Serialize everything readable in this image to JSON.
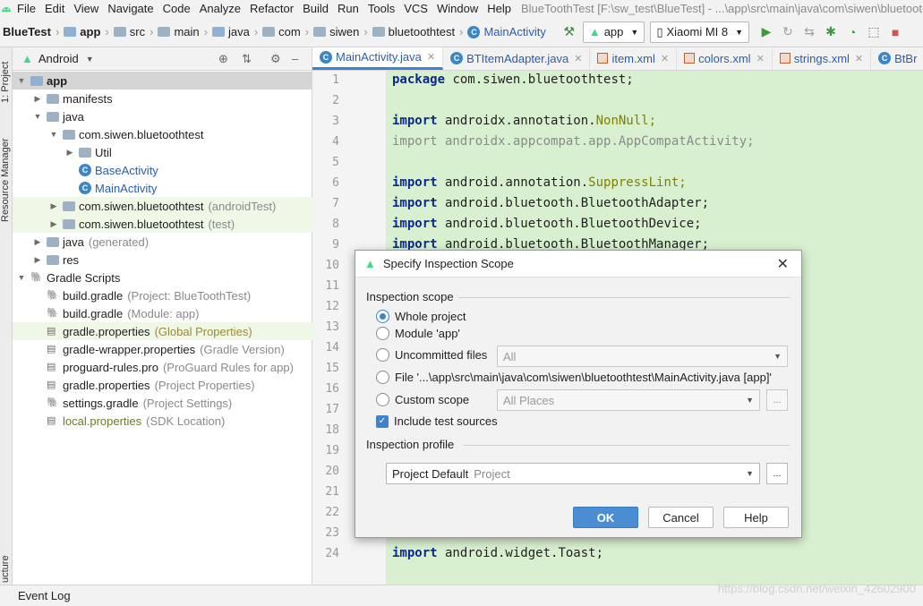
{
  "menubar": {
    "items": [
      "File",
      "Edit",
      "View",
      "Navigate",
      "Code",
      "Analyze",
      "Refactor",
      "Build",
      "Run",
      "Tools",
      "VCS",
      "Window",
      "Help"
    ],
    "window_title": "BlueToothTest [F:\\sw_test\\BlueTest] - ...\\app\\src\\main\\java\\com\\siwen\\bluetoothtest\\MainActivity.java"
  },
  "navbar": {
    "crumbs": [
      "BlueTest",
      "app",
      "src",
      "main",
      "java",
      "com",
      "siwen",
      "bluetoothtest",
      "MainActivity"
    ],
    "run_config": "app",
    "device": "Xiaomi MI 8"
  },
  "left_strip": {
    "project_label": "1: Project",
    "resource_label": "Resource Manager",
    "structure_label": "ucture"
  },
  "project_panel": {
    "view": "Android",
    "tree": [
      {
        "label": "app",
        "extra": "",
        "icon": "module-folder-icon",
        "expand": "open"
      },
      {
        "label": "manifests",
        "extra": "",
        "icon": "folder-icon",
        "expand": "closed"
      },
      {
        "label": "java",
        "extra": "",
        "icon": "folder-icon",
        "expand": "open"
      },
      {
        "label": "com.siwen.bluetoothtest",
        "extra": "",
        "icon": "package-icon",
        "expand": "open"
      },
      {
        "label": "Util",
        "extra": "",
        "icon": "package-icon",
        "expand": "closed"
      },
      {
        "label": "BaseActivity",
        "extra": "",
        "icon": "class-icon",
        "expand": "none"
      },
      {
        "label": "MainActivity",
        "extra": "",
        "icon": "class-icon",
        "expand": "none"
      },
      {
        "label": "com.siwen.bluetoothtest",
        "extra": "(androidTest)",
        "icon": "package-icon",
        "expand": "closed"
      },
      {
        "label": "com.siwen.bluetoothtest",
        "extra": "(test)",
        "icon": "package-icon",
        "expand": "closed"
      },
      {
        "label": "java",
        "extra": "(generated)",
        "icon": "folder-icon",
        "expand": "closed"
      },
      {
        "label": "res",
        "extra": "",
        "icon": "folder-icon",
        "expand": "closed"
      },
      {
        "label": "Gradle Scripts",
        "extra": "",
        "icon": "gradle-icon",
        "expand": "open"
      },
      {
        "label": "build.gradle",
        "extra": "(Project: BlueToothTest)",
        "icon": "gradle-icon",
        "expand": "none"
      },
      {
        "label": "build.gradle",
        "extra": "(Module: app)",
        "icon": "gradle-icon",
        "expand": "none"
      },
      {
        "label": "gradle.properties",
        "extra": "(Global Properties)",
        "icon": "properties-icon",
        "expand": "none"
      },
      {
        "label": "gradle-wrapper.properties",
        "extra": "(Gradle Version)",
        "icon": "properties-icon",
        "expand": "none"
      },
      {
        "label": "proguard-rules.pro",
        "extra": "(ProGuard Rules for app)",
        "icon": "file-icon",
        "expand": "none"
      },
      {
        "label": "gradle.properties",
        "extra": "(Project Properties)",
        "icon": "properties-icon",
        "expand": "none"
      },
      {
        "label": "settings.gradle",
        "extra": "(Project Settings)",
        "icon": "gradle-icon",
        "expand": "none"
      },
      {
        "label": "local.properties",
        "extra": "(SDK Location)",
        "icon": "properties-icon",
        "expand": "none"
      }
    ]
  },
  "editor": {
    "tabs": [
      "MainActivity.java",
      "BTItemAdapter.java",
      "item.xml",
      "colors.xml",
      "strings.xml",
      "BtBr"
    ],
    "line_numbers": [
      "1",
      "2",
      "3",
      "4",
      "5",
      "6",
      "7",
      "8",
      "9",
      "10",
      "11",
      "12",
      "13",
      "14",
      "15",
      "16",
      "17",
      "18",
      "19",
      "20",
      "21",
      "22",
      "23",
      "24"
    ],
    "lines": [
      {
        "kw": "package",
        "rest": " com.siwen.bluetoothtest;",
        "ann": ""
      },
      {
        "kw": "",
        "rest": "",
        "ann": ""
      },
      {
        "kw": "import",
        "rest": " androidx.annotation.",
        "ann": "NonNull;"
      },
      {
        "kw": "import",
        "rest": " androidx.appcompat.app.AppCompatActivity;",
        "ann": ""
      },
      {
        "kw": "",
        "rest": "",
        "ann": ""
      },
      {
        "kw": "import",
        "rest": " android.annotation.",
        "ann": "SuppressLint;"
      },
      {
        "kw": "import",
        "rest": " android.bluetooth.BluetoothAdapter;",
        "ann": ""
      },
      {
        "kw": "import",
        "rest": " android.bluetooth.BluetoothDevice;",
        "ann": ""
      },
      {
        "kw": "import",
        "rest": " android.bluetooth.BluetoothManager;",
        "ann": ""
      }
    ],
    "last_line": {
      "kw": "import",
      "rest": " android.widget.Toast;"
    }
  },
  "status": {
    "event_log": "Event Log",
    "watermark": "https://blog.csdn.net/weixin_42602900"
  },
  "dialog": {
    "title": "Specify Inspection Scope",
    "scope_label": "Inspection scope",
    "options": [
      {
        "label": "Whole project",
        "selected": true
      },
      {
        "label": "Module 'app'",
        "selected": false
      },
      {
        "label": "Uncommitted files",
        "selected": false
      },
      {
        "label": "File '...\\app\\src\\main\\java\\com\\siwen\\bluetoothtest\\MainActivity.java [app]'",
        "selected": false
      },
      {
        "label": "Custom scope",
        "selected": false
      }
    ],
    "uncommitted_value": "All",
    "custom_value": "All Places",
    "include_tests": "Include test sources",
    "profile_label": "Inspection profile",
    "profile_name": "Project Default",
    "profile_sub": "Project",
    "ellipsis": "...",
    "ok": "OK",
    "cancel": "Cancel",
    "help": "Help"
  }
}
